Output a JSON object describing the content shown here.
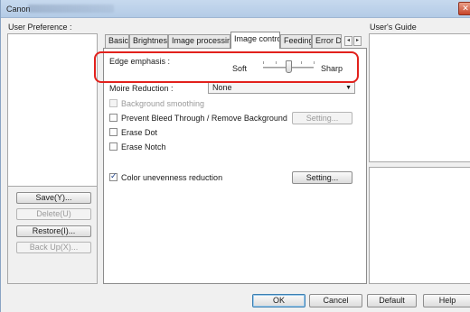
{
  "window": {
    "title_prefix": "Canon"
  },
  "left": {
    "user_preference_label": "User Preference :",
    "buttons": {
      "save": "Save(Y)...",
      "delete": "Delete(U)",
      "restore": "Restore(I)...",
      "backup": "Back Up(X)..."
    }
  },
  "tabs": [
    {
      "label": "Basic"
    },
    {
      "label": "Brightness"
    },
    {
      "label": "Image processing"
    },
    {
      "label": "Image control"
    },
    {
      "label": "Feeding"
    },
    {
      "label": "Error De"
    }
  ],
  "tab_arrows": {
    "left": "◂",
    "right": "▸"
  },
  "edge": {
    "label": "Edge emphasis :",
    "soft": "Soft",
    "sharp": "Sharp",
    "level": 0.5
  },
  "moire": {
    "label": "Moire Reduction :",
    "value": "None",
    "arrow": "▼"
  },
  "options": {
    "background_smoothing": "Background smoothing",
    "prevent_bleed": "Prevent Bleed Through / Remove Background",
    "erase_dot": "Erase Dot",
    "erase_notch": "Erase Notch",
    "color_unevenness": "Color unevenness reduction"
  },
  "setting_buttons": {
    "prevent_bleed": "Setting...",
    "color_unevenness": "Setting..."
  },
  "right": {
    "users_guide_label": "User's Guide"
  },
  "footer": {
    "ok": "OK",
    "cancel": "Cancel",
    "default": "Default",
    "help": "Help"
  },
  "close_glyph": "✕"
}
